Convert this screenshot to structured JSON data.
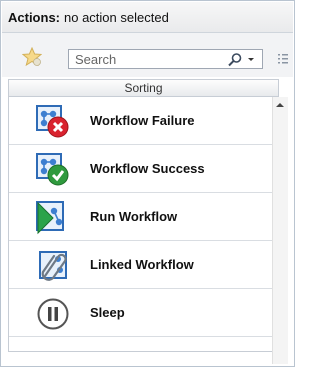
{
  "header": {
    "label": "Actions:",
    "value": "no action selected"
  },
  "toolbar": {
    "favorite_icon": "star-icon",
    "search_placeholder": "Search",
    "search_value": ""
  },
  "sorting": {
    "label": "Sorting"
  },
  "actions": [
    {
      "label": "Workflow Failure",
      "icon": "workflow-failure-icon"
    },
    {
      "label": "Workflow Success",
      "icon": "workflow-success-icon"
    },
    {
      "label": "Run Workflow",
      "icon": "run-workflow-icon"
    },
    {
      "label": "Linked Workflow",
      "icon": "linked-workflow-icon"
    },
    {
      "label": "Sleep",
      "icon": "sleep-icon"
    }
  ]
}
